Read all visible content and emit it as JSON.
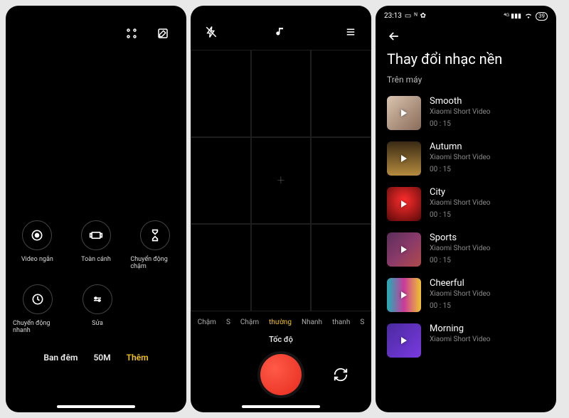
{
  "phone1": {
    "modes_row1": [
      {
        "label": "Video ngắn",
        "icon": "record"
      },
      {
        "label": "Toàn cánh",
        "icon": "panorama"
      },
      {
        "label": "Chuyển động chậm",
        "icon": "hourglass"
      }
    ],
    "modes_row2": [
      {
        "label": "Chuyển động nhanh",
        "icon": "timelapse"
      },
      {
        "label": "Sửa",
        "icon": "settings"
      }
    ],
    "tabs": [
      {
        "label": "Ban đêm",
        "active": false
      },
      {
        "label": "50M",
        "active": false
      },
      {
        "label": "Thêm",
        "active": true
      }
    ]
  },
  "phone2": {
    "speeds": [
      "Chậm",
      "S",
      "Chậm",
      "thường",
      "Nhanh",
      "thanh",
      "S"
    ],
    "speed_selected_index": 3,
    "speed_label": "Tốc độ"
  },
  "phone3": {
    "time": "23:13",
    "battery": "39",
    "title": "Thay đổi nhạc nền",
    "section": "Trên máy",
    "tracks": [
      {
        "title": "Smooth",
        "sub": "Xiaomi Short Video",
        "dur": "00 : 15",
        "thumb": "t1"
      },
      {
        "title": "Autumn",
        "sub": "Xiaomi Short Video",
        "dur": "00 : 15",
        "thumb": "t2"
      },
      {
        "title": "City",
        "sub": "Xiaomi Short Video",
        "dur": "00 : 15",
        "thumb": "t3"
      },
      {
        "title": "Sports",
        "sub": "Xiaomi Short Video",
        "dur": "00 : 15",
        "thumb": "t4"
      },
      {
        "title": "Cheerful",
        "sub": "Xiaomi Short Video",
        "dur": "00 : 15",
        "thumb": "t5"
      },
      {
        "title": "Morning",
        "sub": "Xiaomi Short Video",
        "dur": "",
        "thumb": "t6"
      }
    ]
  }
}
